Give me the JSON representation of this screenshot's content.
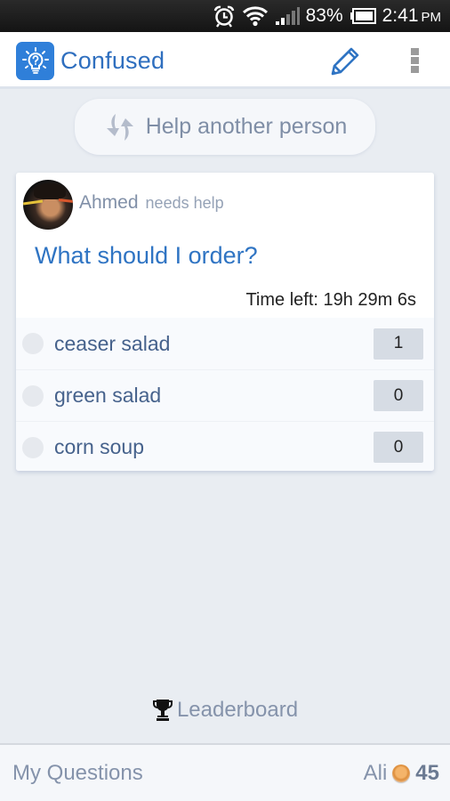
{
  "status_bar": {
    "battery_percent": "83%",
    "time": "2:41",
    "ampm": "PM",
    "icons": [
      "alarm-icon",
      "wifi-icon",
      "signal-icon",
      "battery-icon"
    ]
  },
  "app_bar": {
    "title": "Confused",
    "logo_icon": "lightbulb-question-icon",
    "actions": [
      "edit-icon",
      "more-vert-icon"
    ]
  },
  "help_button": {
    "label": "Help another person",
    "icon": "swap-arrows-icon"
  },
  "question_card": {
    "author": "Ahmed",
    "author_status": "needs help",
    "question": "What should I order?",
    "time_left": "Time left: 19h 29m 6s",
    "options": [
      {
        "label": "ceaser salad",
        "votes": "1"
      },
      {
        "label": "green salad",
        "votes": "0"
      },
      {
        "label": "corn soup",
        "votes": "0"
      }
    ]
  },
  "leaderboard": {
    "label": "Leaderboard",
    "icon": "trophy-icon"
  },
  "bottom_bar": {
    "my_questions": "My Questions",
    "user_name": "Ali",
    "points": "45",
    "coin_icon": "coin-icon"
  },
  "colors": {
    "brand_blue": "#2f7fd9",
    "title_blue": "#2f6fbf",
    "question_blue": "#2f74c3",
    "muted_text": "#8593ab",
    "background": "#e9edf2"
  }
}
